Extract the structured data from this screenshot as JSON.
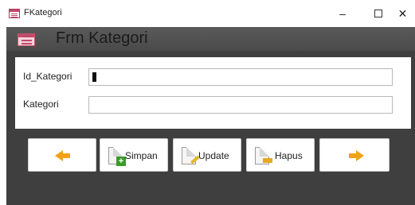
{
  "window": {
    "title": "FKategori",
    "minimize_glyph": "–",
    "close_glyph": "✕"
  },
  "form": {
    "header_title": "Frm Kategori",
    "fields": [
      {
        "label": "Id_Kategori",
        "value": ""
      },
      {
        "label": "Kategori",
        "value": ""
      }
    ]
  },
  "buttons": {
    "prev_icon": "arrow-left-icon",
    "save_label": "Simpan",
    "update_label": "Update",
    "delete_label": "Hapus",
    "next_icon": "arrow-right-icon"
  },
  "colors": {
    "form_background": "#3f3f3f",
    "header_background": "#4f4f4f",
    "arrow_accent": "#f0a318",
    "app_icon": "#c04a6a"
  }
}
